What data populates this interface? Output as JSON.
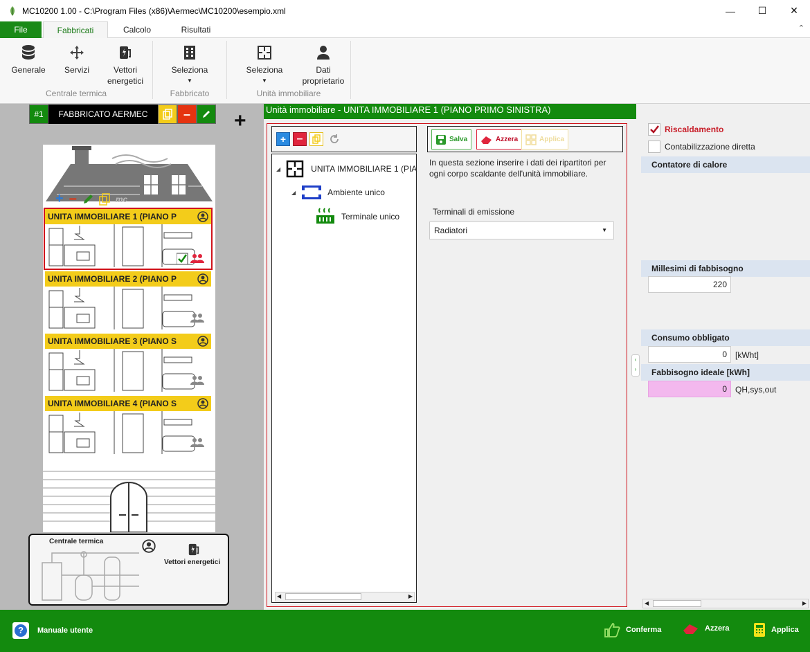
{
  "window": {
    "title": "MC10200 1.00 - C:\\Program Files (x86)\\Aermec\\MC10200\\esempio.xml"
  },
  "tabs": {
    "file": "File",
    "fabbricati": "Fabbricati",
    "calcolo": "Calcolo",
    "risultati": "Risultati"
  },
  "ribbon": {
    "generale": "Generale",
    "servizi": "Servizi",
    "vettori_1": "Vettori",
    "vettori_2": "energetici",
    "group_centrale": "Centrale termica",
    "seleziona_fabbricato": "Seleziona",
    "group_fabbricato": "Fabbricato",
    "seleziona_unita": "Seleziona",
    "dati_1": "Dati",
    "dati_2": "proprietario",
    "group_unita": "Unità immobiliare"
  },
  "building": {
    "number": "#1",
    "name": "FABBRICATO AERMEC",
    "units": [
      "UNITA IMMOBILIARE 1 (PIANO P",
      "UNITA IMMOBILIARE 2 (PIANO P",
      "UNITA IMMOBILIARE 3 (PIANO S",
      "UNITA IMMOBILIARE 4 (PIANO S"
    ],
    "roof_mc": "mc",
    "centrale_label": "Centrale termica",
    "vettori_label": "Vettori energetici"
  },
  "panel": {
    "header": "Unità immobiliare - UNITA IMMOBILIARE 1 (PIANO PRIMO SINISTRA)",
    "tree": {
      "root": "UNITA IMMOBILIARE 1 (PIA",
      "ambiente": "Ambiente unico",
      "terminale": "Terminale unico"
    },
    "actions": {
      "salva": "Salva",
      "azzera": "Azzera",
      "applica": "Applica"
    },
    "info_line1": "In questa sezione inserire i dati dei ripartitori per",
    "info_line2": "ogni corpo scaldante dell'unità immobiliare.",
    "terminali_label": "Terminali di emissione",
    "terminali_value": "Radiatori"
  },
  "right": {
    "riscaldamento": "Riscaldamento",
    "contabilizzazione": "Contabilizzazione diretta",
    "contatore": "Contatore di calore",
    "millesimi": "Millesimi di fabbisogno",
    "millesimi_value": "220",
    "consumo": "Consumo obbligato",
    "consumo_value": "0",
    "consumo_unit": "[kWht]",
    "fabbisogno": "Fabbisogno ideale [kWh]",
    "fabbisogno_value": "0",
    "fabbisogno_unit": "QH,sys,out"
  },
  "footer": {
    "manuale": "Manuale utente",
    "conferma": "Conferma",
    "azzera": "Azzera",
    "applica": "Applica"
  },
  "colors": {
    "green": "#138a0e",
    "yellow": "#f3cc1a",
    "red": "#d0121b",
    "pink": "#f3b8ee"
  }
}
